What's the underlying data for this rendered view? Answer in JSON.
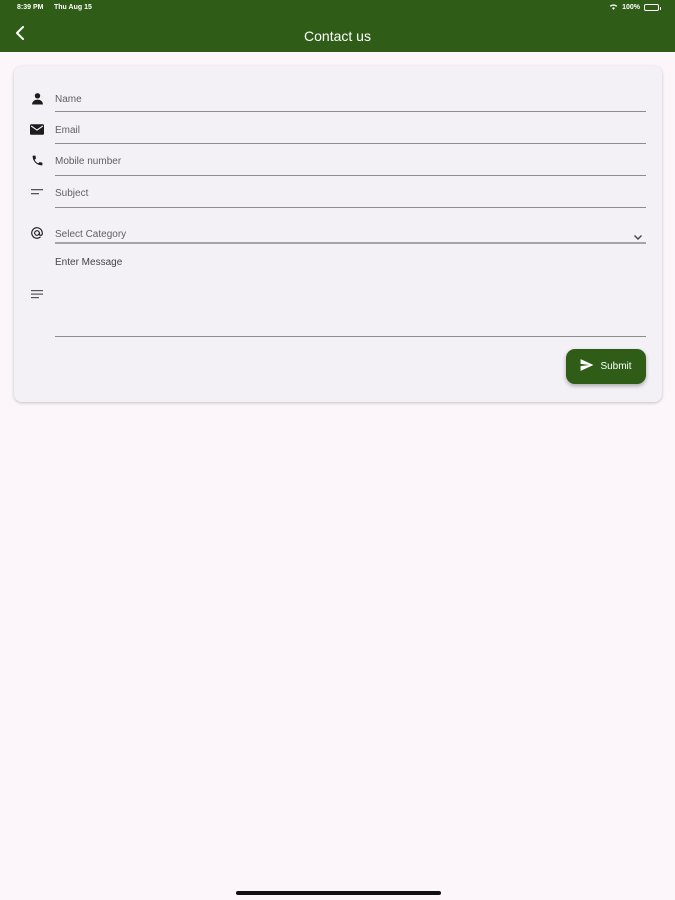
{
  "status_bar": {
    "time": "8:39 PM",
    "date": "Thu Aug 15",
    "battery": "100%"
  },
  "app_bar": {
    "title": "Contact us",
    "back_icon": "chevron-left-icon"
  },
  "form": {
    "fields": [
      {
        "placeholder": "Name",
        "icon": "person-icon"
      },
      {
        "placeholder": "Email",
        "icon": "mail-icon"
      },
      {
        "placeholder": "Mobile number",
        "icon": "phone-icon"
      },
      {
        "placeholder": "Subject",
        "icon": "short-text-icon"
      }
    ],
    "category": {
      "placeholder": "Select Category",
      "icon": "at-icon"
    },
    "message": {
      "label": "Enter Message",
      "icon": "notes-icon"
    },
    "submit_label": "Submit"
  },
  "colors": {
    "primary": "#2f5d17",
    "background": "#fcf6fb",
    "card": "#f4f1f6"
  }
}
